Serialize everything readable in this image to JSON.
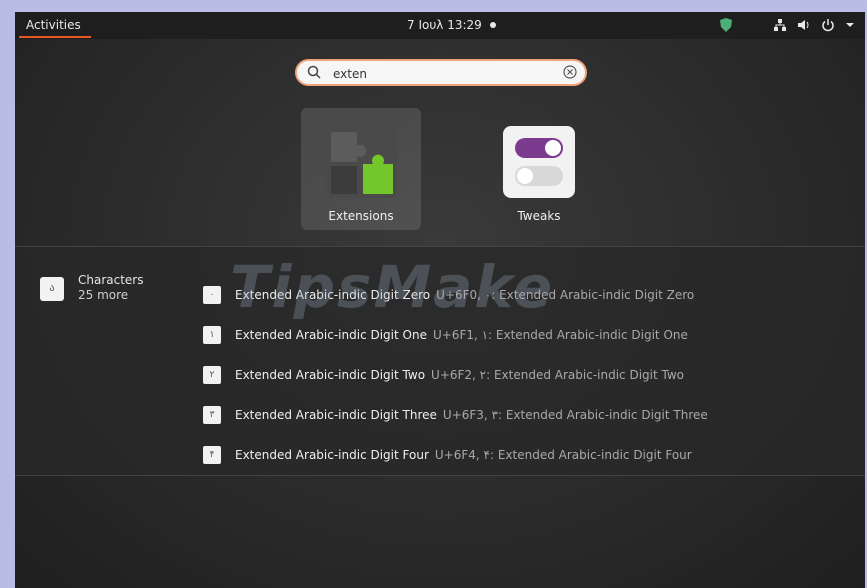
{
  "topbar": {
    "activities_label": "Activities",
    "clock": "7 Ιουλ 13:29",
    "tray_icons": [
      "shield-icon",
      "network-icon",
      "volume-icon",
      "power-icon",
      "chevron-down-icon"
    ]
  },
  "search": {
    "value": "exten"
  },
  "apps": [
    {
      "label": "Extensions",
      "icon": "puzzle-icon",
      "selected": true
    },
    {
      "label": "Tweaks",
      "icon": "toggle-icon",
      "selected": false
    }
  ],
  "results": {
    "provider": {
      "name": "Characters",
      "more": "25 more",
      "icon_glyph": "ა"
    },
    "items": [
      {
        "title": "Extended Arabic-indic Digit Zero",
        "desc": "U+6F0, ۰: Extended Arabic-indic Digit Zero",
        "glyph": "۰"
      },
      {
        "title": "Extended Arabic-indic Digit One",
        "desc": "U+6F1, ۱: Extended Arabic-indic Digit One",
        "glyph": "۱"
      },
      {
        "title": "Extended Arabic-indic Digit Two",
        "desc": "U+6F2, ۲: Extended Arabic-indic Digit Two",
        "glyph": "۲"
      },
      {
        "title": "Extended Arabic-indic Digit Three",
        "desc": "U+6F3, ۳: Extended Arabic-indic Digit Three",
        "glyph": "۳"
      },
      {
        "title": "Extended Arabic-indic Digit Four",
        "desc": "U+6F4, ۴: Extended Arabic-indic Digit Four",
        "glyph": "۴"
      }
    ]
  },
  "watermark": "TipsMake",
  "colors": {
    "accent": "#e95420",
    "puzzle": "#73c72c",
    "toggle": "#7c3b8f"
  }
}
